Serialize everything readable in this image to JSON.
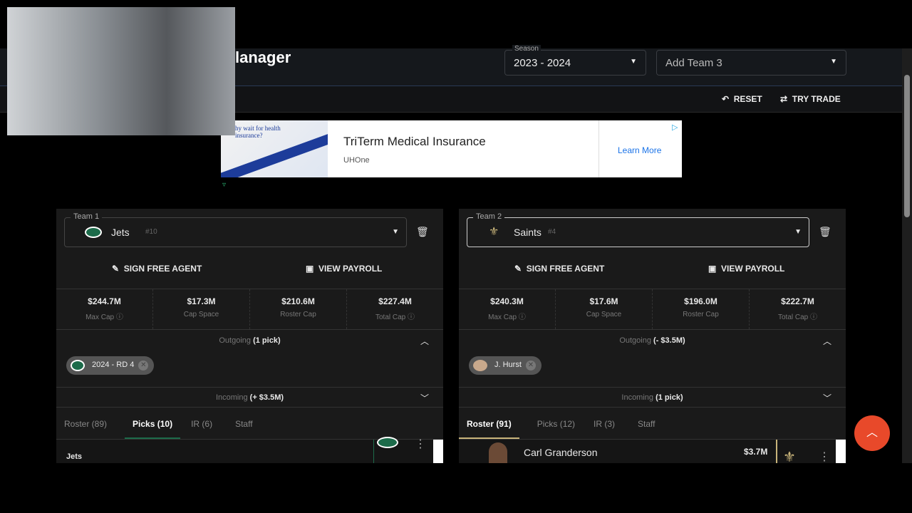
{
  "header": {
    "title": "lanager",
    "season_label": "Season",
    "season_value": "2023 - 2024",
    "add_team_placeholder": "Add Team 3"
  },
  "toolbar": {
    "reset": "RESET",
    "try_trade": "TRY TRADE"
  },
  "ad": {
    "image_text": "hy wait for health insurance?",
    "title": "TriTerm Medical Insurance",
    "advertiser": "UHOne",
    "cta": "Learn More"
  },
  "teams": [
    {
      "label": "Team 1",
      "name": "Jets",
      "rank": "#10",
      "accent": "#1c6b4a",
      "sign": "SIGN FREE AGENT",
      "payroll": "VIEW PAYROLL",
      "stats": [
        {
          "v": "$244.7M",
          "l": "Max Cap",
          "info": true
        },
        {
          "v": "$17.3M",
          "l": "Cap Space"
        },
        {
          "v": "$210.6M",
          "l": "Roster Cap"
        },
        {
          "v": "$227.4M",
          "l": "Total Cap",
          "info": true
        }
      ],
      "outgoing_label": "Outgoing",
      "outgoing_value": "(1 pick)",
      "chip": "2024 - RD 4",
      "incoming_label": "Incoming",
      "incoming_value": "(+ $3.5M)",
      "tabs": [
        "Roster (89)",
        "Picks (10)",
        "IR (6)",
        "Staff"
      ],
      "active_tab": 1,
      "row_text": "Jets"
    },
    {
      "label": "Team 2",
      "name": "Saints",
      "rank": "#4",
      "accent": "#c8b47a",
      "sign": "SIGN FREE AGENT",
      "payroll": "VIEW PAYROLL",
      "stats": [
        {
          "v": "$240.3M",
          "l": "Max Cap",
          "info": true
        },
        {
          "v": "$17.6M",
          "l": "Cap Space"
        },
        {
          "v": "$196.0M",
          "l": "Roster Cap"
        },
        {
          "v": "$222.7M",
          "l": "Total Cap",
          "info": true
        }
      ],
      "outgoing_label": "Outgoing",
      "outgoing_value": "(- $3.5M)",
      "chip": "J. Hurst",
      "incoming_label": "Incoming",
      "incoming_value": "(1 pick)",
      "tabs": [
        "Roster (91)",
        "Picks (12)",
        "IR (3)",
        "Staff"
      ],
      "active_tab": 0,
      "row_text": "Carl Granderson",
      "row_amount": "$3.7M"
    }
  ]
}
